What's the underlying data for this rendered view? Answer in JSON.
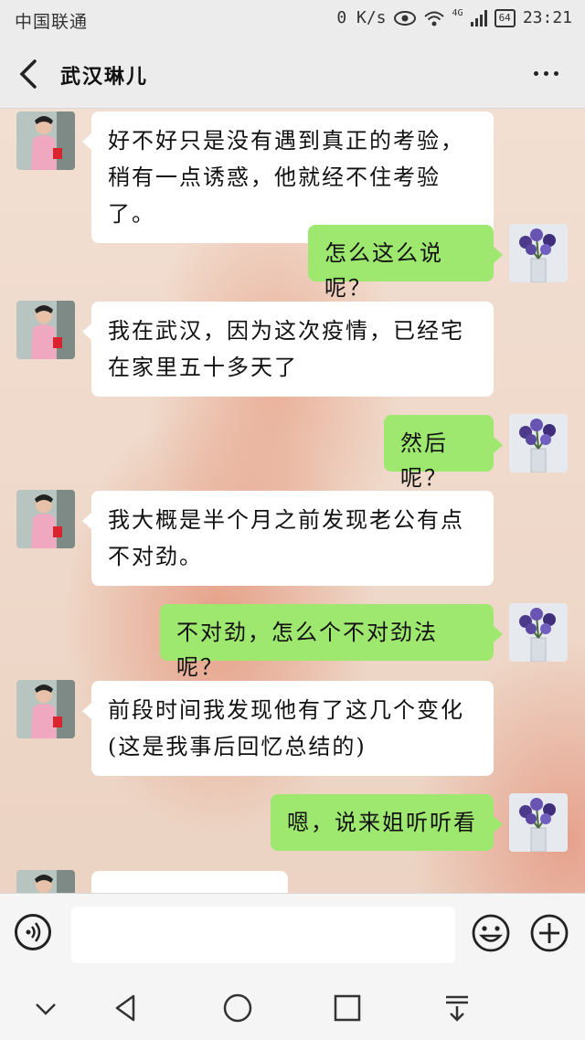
{
  "status_bar": {
    "carrier": "中国联通",
    "network_speed": "0 K/s",
    "signal_type": "4G",
    "battery": "64",
    "time": "23:21"
  },
  "header": {
    "title": "武汉琳儿",
    "back_icon": "chevron-left-icon",
    "more_icon": "more-dots-icon"
  },
  "messages": [
    {
      "side": "left",
      "text": "好不好只是没有遇到真正的考验，稍有一点诱惑，他就经不住考验了。"
    },
    {
      "side": "right",
      "text": "怎么这么说呢？"
    },
    {
      "side": "left",
      "text": "我在武汉，因为这次疫情，已经宅在家里五十多天了"
    },
    {
      "side": "right",
      "text": "然后呢？"
    },
    {
      "side": "left",
      "text": "我大概是半个月之前发现老公有点不对劲。"
    },
    {
      "side": "right",
      "text": "不对劲，怎么个不对劲法呢？"
    },
    {
      "side": "left",
      "text": "前段时间我发现他有了这几个变化(这是我事后回忆总结的)"
    },
    {
      "side": "right",
      "text": "嗯，说来姐听听看"
    },
    {
      "side": "left",
      "text": ""
    }
  ],
  "input_bar": {
    "voice_icon": "voice-input-icon",
    "text_value": "",
    "emoji_icon": "emoji-icon",
    "plus_icon": "plus-icon"
  },
  "nav_bar": {
    "icons": [
      "chevron-down-icon",
      "back-triangle-icon",
      "home-circle-icon",
      "recents-square-icon",
      "notification-pull-icon"
    ]
  },
  "colors": {
    "sent_bubble": "#9fe870",
    "received_bubble": "#ffffff",
    "bar_background": "#ececec"
  }
}
